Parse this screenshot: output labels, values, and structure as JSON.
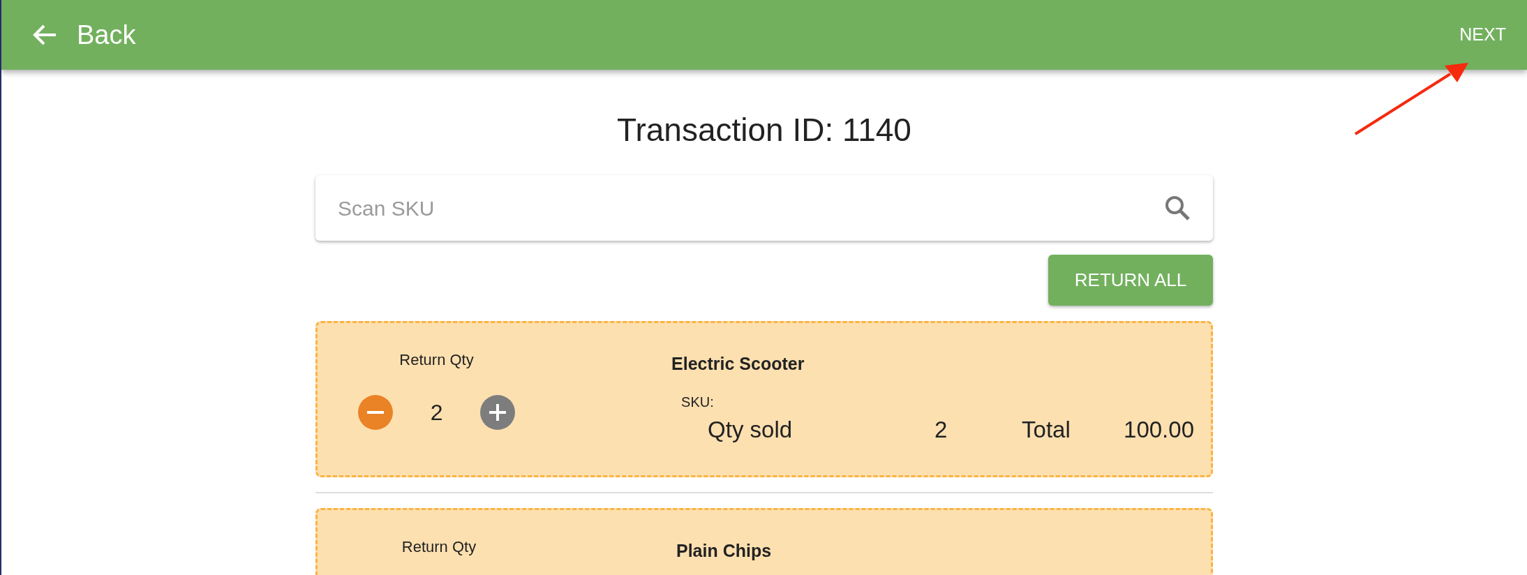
{
  "header": {
    "back_label": "Back",
    "next_label": "NEXT"
  },
  "title": "Transaction ID: 1140",
  "search": {
    "placeholder": "Scan SKU"
  },
  "return_all_label": "RETURN ALL",
  "items": [
    {
      "return_qty_label": "Return Qty",
      "return_qty": "2",
      "name": "Electric Scooter",
      "sku_label": "SKU:",
      "qty_sold_label": "Qty sold",
      "qty_sold": "2",
      "total_label": "Total",
      "total": "100.00"
    },
    {
      "return_qty_label": "Return Qty",
      "name": "Plain Chips"
    }
  ],
  "annotation": {
    "kind": "arrow"
  }
}
